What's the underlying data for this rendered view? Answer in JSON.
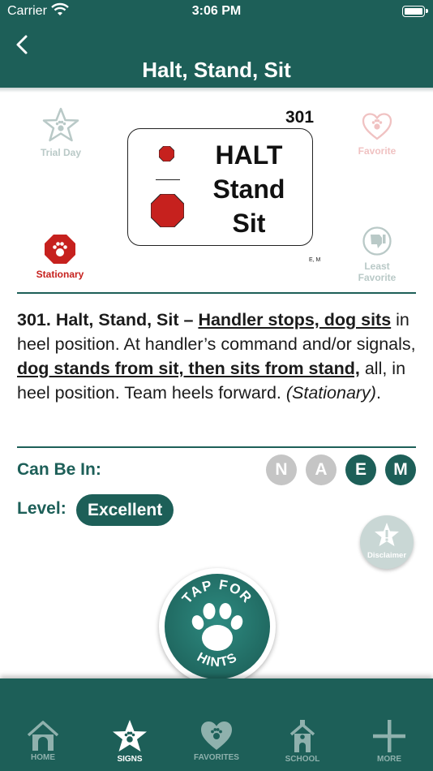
{
  "status_bar": {
    "carrier": "Carrier",
    "time": "3:06 PM"
  },
  "nav": {
    "title": "Halt, Stand, Sit"
  },
  "side_buttons": {
    "trial_day": "Trial Day",
    "favorite": "Favorite",
    "stationary": "Stationary",
    "least_favorite_1": "Least",
    "least_favorite_2": "Favorite"
  },
  "sign": {
    "number": "301",
    "line1": "HALT",
    "line2": "Stand",
    "line3": "Sit",
    "classes_tag": "E, M"
  },
  "description": {
    "lead": "301. Halt, Stand, Sit – ",
    "u1": "Handler stops, dog sits",
    "t1": " in heel position. At handler’s command and/or signals, ",
    "u2": "dog stands from sit, then sits from stand,",
    "t2": " all, in heel position. Team heels forward. ",
    "note": "(Stationary)",
    "end": "."
  },
  "can_be_in": {
    "label": "Can Be In:",
    "classes": [
      {
        "letter": "N",
        "active": false
      },
      {
        "letter": "A",
        "active": false
      },
      {
        "letter": "E",
        "active": true
      },
      {
        "letter": "M",
        "active": true
      }
    ]
  },
  "level": {
    "label": "Level:",
    "value": "Excellent"
  },
  "disclaimer": {
    "label": "Disclaimer"
  },
  "hints": {
    "top": "TAP FOR",
    "bottom": "HINTS"
  },
  "tabs": [
    {
      "label": "HOME",
      "icon": "home-icon",
      "active": false
    },
    {
      "label": "SIGNS",
      "icon": "star-icon",
      "active": true
    },
    {
      "label": "FAVORITES",
      "icon": "heart-icon",
      "active": false
    },
    {
      "label": "SCHOOL",
      "icon": "school-icon",
      "active": false
    },
    {
      "label": "MORE",
      "icon": "plus-icon",
      "active": false
    }
  ],
  "colors": {
    "primary": "#1d5f58",
    "stop_red": "#c6211e",
    "inactive": "#c5c5c5"
  }
}
